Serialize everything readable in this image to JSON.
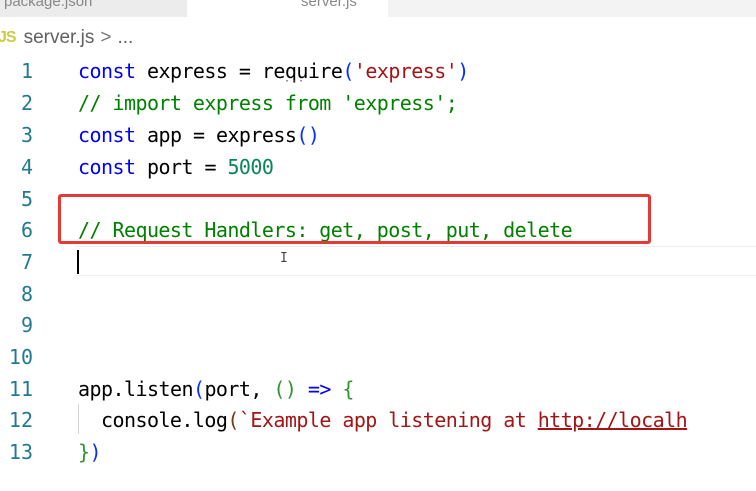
{
  "tabs": [
    {
      "label": "package.json",
      "active": false
    },
    {
      "label": "server.js",
      "active": true
    }
  ],
  "breadcrumb": {
    "icon": "JS",
    "file": "server.js",
    "separator": ">",
    "more": "..."
  },
  "editor": {
    "language": "javascript",
    "lines": [
      {
        "number": "1",
        "text": "const express = require('express')"
      },
      {
        "number": "2",
        "text": "// import express from 'express';"
      },
      {
        "number": "3",
        "text": "const app = express()"
      },
      {
        "number": "4",
        "text": "const port = 5000"
      },
      {
        "number": "5",
        "text": ""
      },
      {
        "number": "6",
        "text": "// Request Handlers: get, post, put, delete"
      },
      {
        "number": "7",
        "text": ""
      },
      {
        "number": "8",
        "text": ""
      },
      {
        "number": "9",
        "text": ""
      },
      {
        "number": "10",
        "text": ""
      },
      {
        "number": "11",
        "text": "app.listen(port, () => {"
      },
      {
        "number": "12",
        "text": "  console.log(`Example app listening at http://localh"
      },
      {
        "number": "13",
        "text": "})"
      }
    ],
    "cursor_line": "7",
    "annotation": "red box highlighting line 6"
  },
  "colors": {
    "keyword": "#0000ff",
    "comment": "#008000",
    "string": "#a31515",
    "number": "#098658",
    "line_number": "#237893",
    "highlight_box": "#e53935"
  }
}
